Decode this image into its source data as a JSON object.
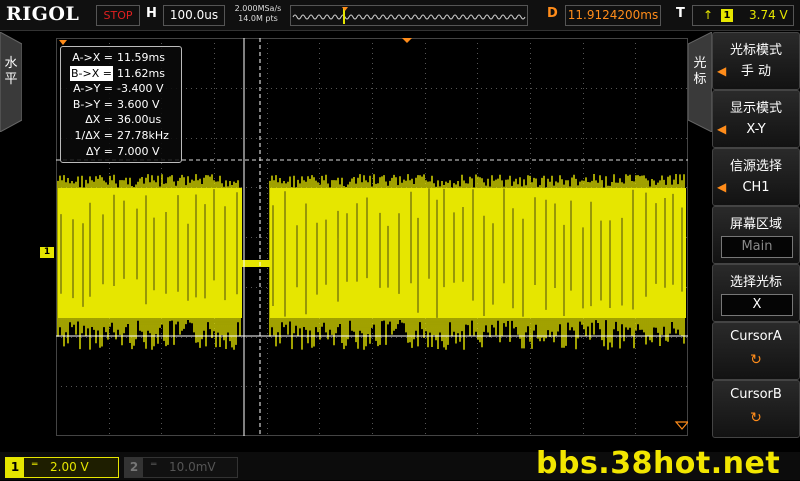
{
  "app": {
    "brand": "RIGOL"
  },
  "status": {
    "run_state": "STOP"
  },
  "horizontal": {
    "label": "H",
    "timebase": "100.0us",
    "sample_rate": "2.000MSa/s",
    "memory_depth": "14.0M pts",
    "delay_label": "D",
    "delay_value": "11.9124200ms"
  },
  "trigger": {
    "label": "T",
    "edge_symbol": "↑",
    "source_channel": "1",
    "level": "3.74 V"
  },
  "left_tab": {
    "label": "水平"
  },
  "right_tab": {
    "label": "光标"
  },
  "cursor_readout": {
    "rows": [
      {
        "key": "A->X =",
        "value": "11.59ms",
        "selected": false
      },
      {
        "key": "B->X =",
        "value": "11.62ms",
        "selected": true
      },
      {
        "key": "A->Y =",
        "value": "-3.400 V",
        "selected": false
      },
      {
        "key": "B->Y =",
        "value": "3.600 V",
        "selected": false
      },
      {
        "key": "ΔX =",
        "value": "36.00us",
        "selected": false
      },
      {
        "key": "1/ΔX =",
        "value": "27.78kHz",
        "selected": false
      },
      {
        "key": "ΔY =",
        "value": "7.000 V",
        "selected": false
      }
    ]
  },
  "channel_marker": {
    "label": "1"
  },
  "menu": {
    "items": [
      {
        "title": "光标模式",
        "value": "手  动",
        "style": "arrow"
      },
      {
        "title": "显示模式",
        "value": "X-Y",
        "style": "arrow"
      },
      {
        "title": "信源选择",
        "value": "CH1",
        "style": "arrow"
      },
      {
        "title": "屏幕区域",
        "value": "Main",
        "style": "box-dim"
      },
      {
        "title": "选择光标",
        "value": "X",
        "style": "box"
      },
      {
        "title": "CursorA",
        "value": "↻",
        "style": "knob"
      },
      {
        "title": "CursorB",
        "value": "↻",
        "style": "knob"
      }
    ]
  },
  "channels": {
    "ch1": {
      "number": "1",
      "coupling": "═",
      "scale": "2.00 V"
    },
    "ch2": {
      "number": "2",
      "coupling": "═",
      "scale": "10.0mV"
    }
  },
  "watermark": "bbs.38hot.net",
  "colors": {
    "ch1": "#e6e600",
    "trigger": "#ff8c1a",
    "stop": "#e02020"
  }
}
